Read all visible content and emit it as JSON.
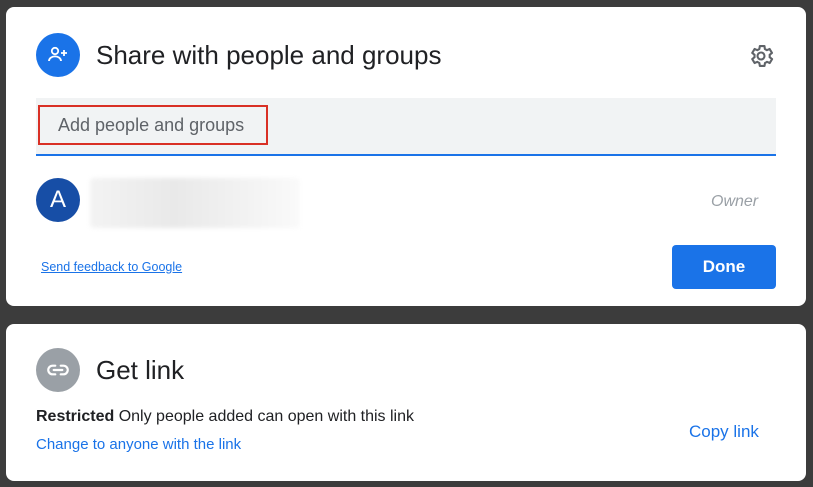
{
  "share_dialog": {
    "title": "Share with people and groups",
    "add_people_placeholder": "Add people and groups",
    "user": {
      "avatar_letter": "A",
      "role": "Owner"
    },
    "feedback_link": "Send feedback to Google",
    "done_label": "Done"
  },
  "link_dialog": {
    "title": "Get link",
    "access_level": "Restricted",
    "access_description": "Only people added can open with this link",
    "change_link": "Change to anyone with the link",
    "copy_link": "Copy link"
  },
  "icons": {
    "share": "person-add-icon",
    "settings": "gear-icon",
    "link": "link-icon"
  },
  "colors": {
    "accent": "#1a73e8",
    "highlight": "#d93025",
    "avatar": "#174ea6",
    "link_icon_bg": "#9aa0a6"
  }
}
